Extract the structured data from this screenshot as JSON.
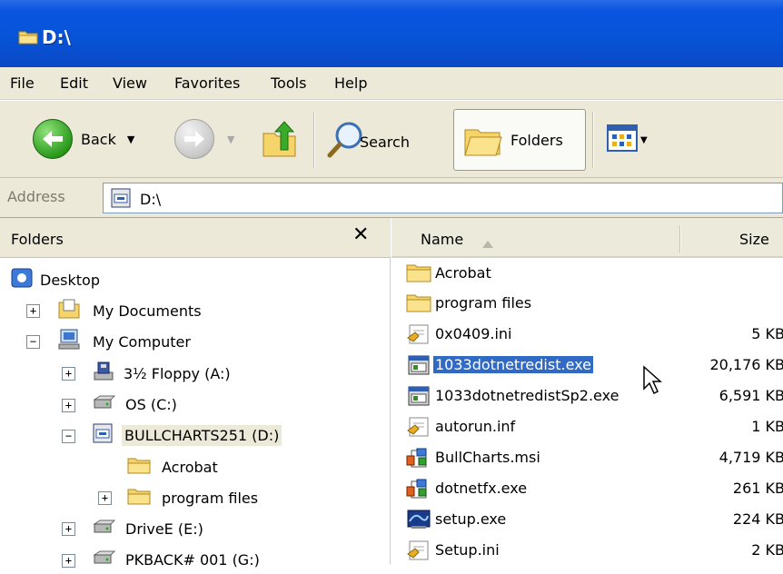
{
  "window": {
    "title": "D:\\"
  },
  "menu": [
    "File",
    "Edit",
    "View",
    "Favorites",
    "Tools",
    "Help"
  ],
  "toolbar": {
    "back_label": "Back",
    "search_label": "Search",
    "folders_label": "Folders"
  },
  "address": {
    "label": "Address",
    "value": "D:\\"
  },
  "folders_pane": {
    "title": "Folders",
    "close_glyph": "✕",
    "tree": [
      {
        "label": "Desktop"
      },
      {
        "label": "My Documents"
      },
      {
        "label": "My Computer"
      },
      {
        "label": "3½ Floppy (A:)"
      },
      {
        "label": "OS (C:)"
      },
      {
        "label": "BULLCHARTS251 (D:)"
      },
      {
        "label": "Acrobat"
      },
      {
        "label": "program files"
      },
      {
        "label": "DriveE (E:)"
      },
      {
        "label": "PKBACK# 001 (G:)"
      }
    ]
  },
  "file_list": {
    "columns": {
      "name": "Name",
      "size": "Size"
    },
    "files": [
      {
        "name": "Acrobat",
        "size": "",
        "icon": "folder-icon"
      },
      {
        "name": "program files",
        "size": "",
        "icon": "folder-icon"
      },
      {
        "name": "0x0409.ini",
        "size": "5 KB",
        "icon": "ini-file-icon"
      },
      {
        "name": "1033dotnetredist.exe",
        "size": "20,176 KB",
        "icon": "exe-installer-icon",
        "selected": true
      },
      {
        "name": "1033dotnetredistSp2.exe",
        "size": "6,591 KB",
        "icon": "exe-installer-icon"
      },
      {
        "name": "autorun.inf",
        "size": "1 KB",
        "icon": "inf-file-icon"
      },
      {
        "name": "BullCharts.msi",
        "size": "4,719 KB",
        "icon": "msi-package-icon"
      },
      {
        "name": "dotnetfx.exe",
        "size": "261 KB",
        "icon": "msi-package-icon"
      },
      {
        "name": "setup.exe",
        "size": "224 KB",
        "icon": "setup-exe-icon"
      },
      {
        "name": "Setup.ini",
        "size": "2 KB",
        "icon": "ini-file-icon"
      }
    ]
  },
  "colors": {
    "titlebar": "#0a55e0",
    "chrome": "#ece9d8",
    "selection": "#316ac5"
  }
}
